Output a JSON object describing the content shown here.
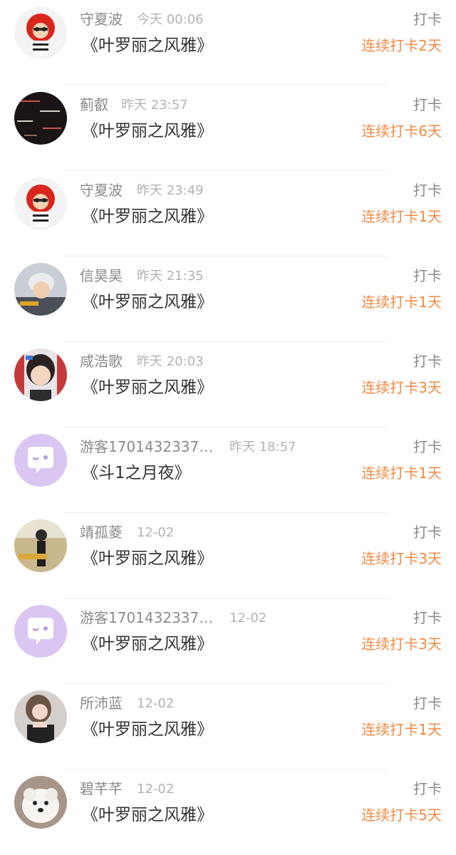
{
  "colors": {
    "accent_orange": "#f08a44",
    "name_gray": "#8a8a8a",
    "time_gray": "#b2b2b2",
    "title_dark": "#333333",
    "guest_avatar_purple": "#d9c6f2"
  },
  "items": [
    {
      "name": "守夏波",
      "time": "今天 00:06",
      "title": "《叶罗丽之风雅》",
      "checkin": "打卡",
      "streak": "连续打卡2天",
      "avatar": "red-ball-character-avatar"
    },
    {
      "name": "蓟叡",
      "time": "昨天 23:57",
      "title": "《叶罗丽之风雅》",
      "checkin": "打卡",
      "streak": "连续打卡6天",
      "avatar": "dark-text-avatar"
    },
    {
      "name": "守夏波",
      "time": "昨天 23:49",
      "title": "《叶罗丽之风雅》",
      "checkin": "打卡",
      "streak": "连续打卡1天",
      "avatar": "red-ball-character-avatar"
    },
    {
      "name": "信昊昊",
      "time": "昨天 21:35",
      "title": "《叶罗丽之风雅》",
      "checkin": "打卡",
      "streak": "连续打卡1天",
      "avatar": "person-photo-avatar"
    },
    {
      "name": "咸浩歌",
      "time": "昨天 20:03",
      "title": "《叶罗丽之风雅》",
      "checkin": "打卡",
      "streak": "连续打卡3天",
      "avatar": "girl-photo-avatar"
    },
    {
      "name": "游客17014323379...",
      "time": "昨天 18:57",
      "title": "《斗1之月夜》",
      "checkin": "打卡",
      "streak": "连续打卡1天",
      "avatar": "guest-chat-bubble-icon"
    },
    {
      "name": "靖孤菱",
      "time": "12-02",
      "title": "《叶罗丽之风雅》",
      "checkin": "打卡",
      "streak": "连续打卡3天",
      "avatar": "field-photo-avatar"
    },
    {
      "name": "游客17014323379...",
      "time": "12-02",
      "title": "《叶罗丽之风雅》",
      "checkin": "打卡",
      "streak": "连续打卡3天",
      "avatar": "guest-chat-bubble-icon"
    },
    {
      "name": "所沛蓝",
      "time": "12-02",
      "title": "《叶罗丽之风雅》",
      "checkin": "打卡",
      "streak": "连续打卡1天",
      "avatar": "woman-photo-avatar"
    },
    {
      "name": "碧芊芊",
      "time": "12-02",
      "title": "《叶罗丽之风雅》",
      "checkin": "打卡",
      "streak": "连续打卡5天",
      "avatar": "white-dog-avatar"
    }
  ]
}
